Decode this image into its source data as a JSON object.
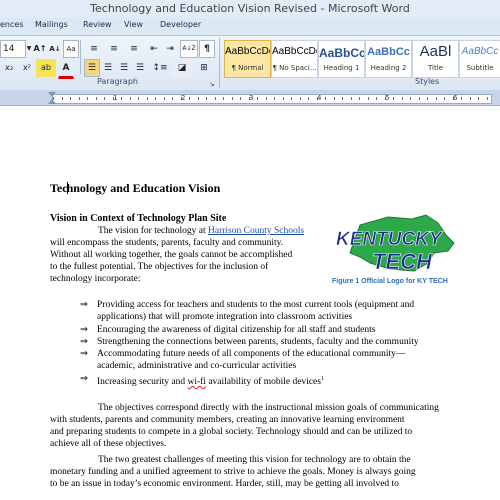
{
  "window": {
    "title": "Technology and Education Vision Revised - Microsoft Word"
  },
  "tabs": [
    "ences",
    "Mailings",
    "Review",
    "View",
    "Developer"
  ],
  "ribbon": {
    "font_size": "14",
    "paragraph_label": "Paragraph",
    "styles_label": "Styles",
    "styles": [
      {
        "sample": "AaBbCcDc",
        "name": "¶ Normal"
      },
      {
        "sample": "AaBbCcDc",
        "name": "¶ No Spaci..."
      },
      {
        "sample": "AaBbCc",
        "name": "Heading 1"
      },
      {
        "sample": "AaBbCc",
        "name": "Heading 2"
      },
      {
        "sample": "AaBl",
        "name": "Title"
      },
      {
        "sample": "AaBbCc",
        "name": "Subtitle"
      }
    ],
    "icons": {
      "grow_font": "A↑",
      "shrink_font": "A↓",
      "clear_format": "Aa",
      "bullets": "≡",
      "numbering": "≡",
      "multilevel": "≡",
      "decrease_indent": "⇤",
      "increase_indent": "⇥",
      "sort": "A↓Z",
      "pilcrow": "¶",
      "highlight": "ab",
      "font_color": "A"
    }
  },
  "ruler": {
    "numbers": [
      "1",
      "2",
      "3",
      "4",
      "5",
      "6"
    ]
  },
  "document": {
    "title_before_cursor": "Tec",
    "title_after_cursor": "hnology and Education Vision",
    "section_title": "Vision in Context of Technology Plan Site",
    "intro_part1": "The vision for technology at ",
    "intro_link": "Harrison County Schools",
    "intro_lines": [
      "will encompass the students, parents, faculty and community.",
      "Without all working together, the goals cannot be accomplished",
      "to the fullest potential.  The objectives for the inclusion  of",
      "technology incorporate:"
    ],
    "logo_text_top": "KENTUCKY",
    "logo_text_bottom": "TECH",
    "figure_caption": "Figure 1 Official Logo for KY TECH",
    "bullets": [
      {
        "line1": "Providing access for teachers and students to the most current tools (equipment and",
        "line2": "applications) that will promote integration into classroom activities"
      },
      {
        "line1": "Encouraging the awareness of digital citizenship  for all staff and students"
      },
      {
        "line1": "Strengthening the connections between parents, students, faculty and the community"
      },
      {
        "line1": "Accommodating future needs of all components of the educational community—",
        "line2": "academic, administrative and co-curricular activities"
      },
      {
        "line1_before": "Increasing security and ",
        "line1_squig": "wi-fi",
        "line1_after": " availability  of mobile devices",
        "superscript": "1"
      }
    ],
    "bullet_symbol": "⇒",
    "objectives_lines": [
      "The objectives correspond directly with the instructional mission goals of communicating",
      "with students, parents and community members, creating an innovative learning  environment",
      "and preparing students to compete in a global society.  Technology should and can be utilized to",
      "achieve all of these objectives."
    ],
    "challenges_lines": [
      "The two greatest challenges of meeting this vision for technology are to obtain the",
      "monetary funding and a unified agreement to strive to achieve the goals.  Money is always going",
      "to be an issue in today’s economic  environment.  Harder, still, may be getting all involved to"
    ]
  }
}
